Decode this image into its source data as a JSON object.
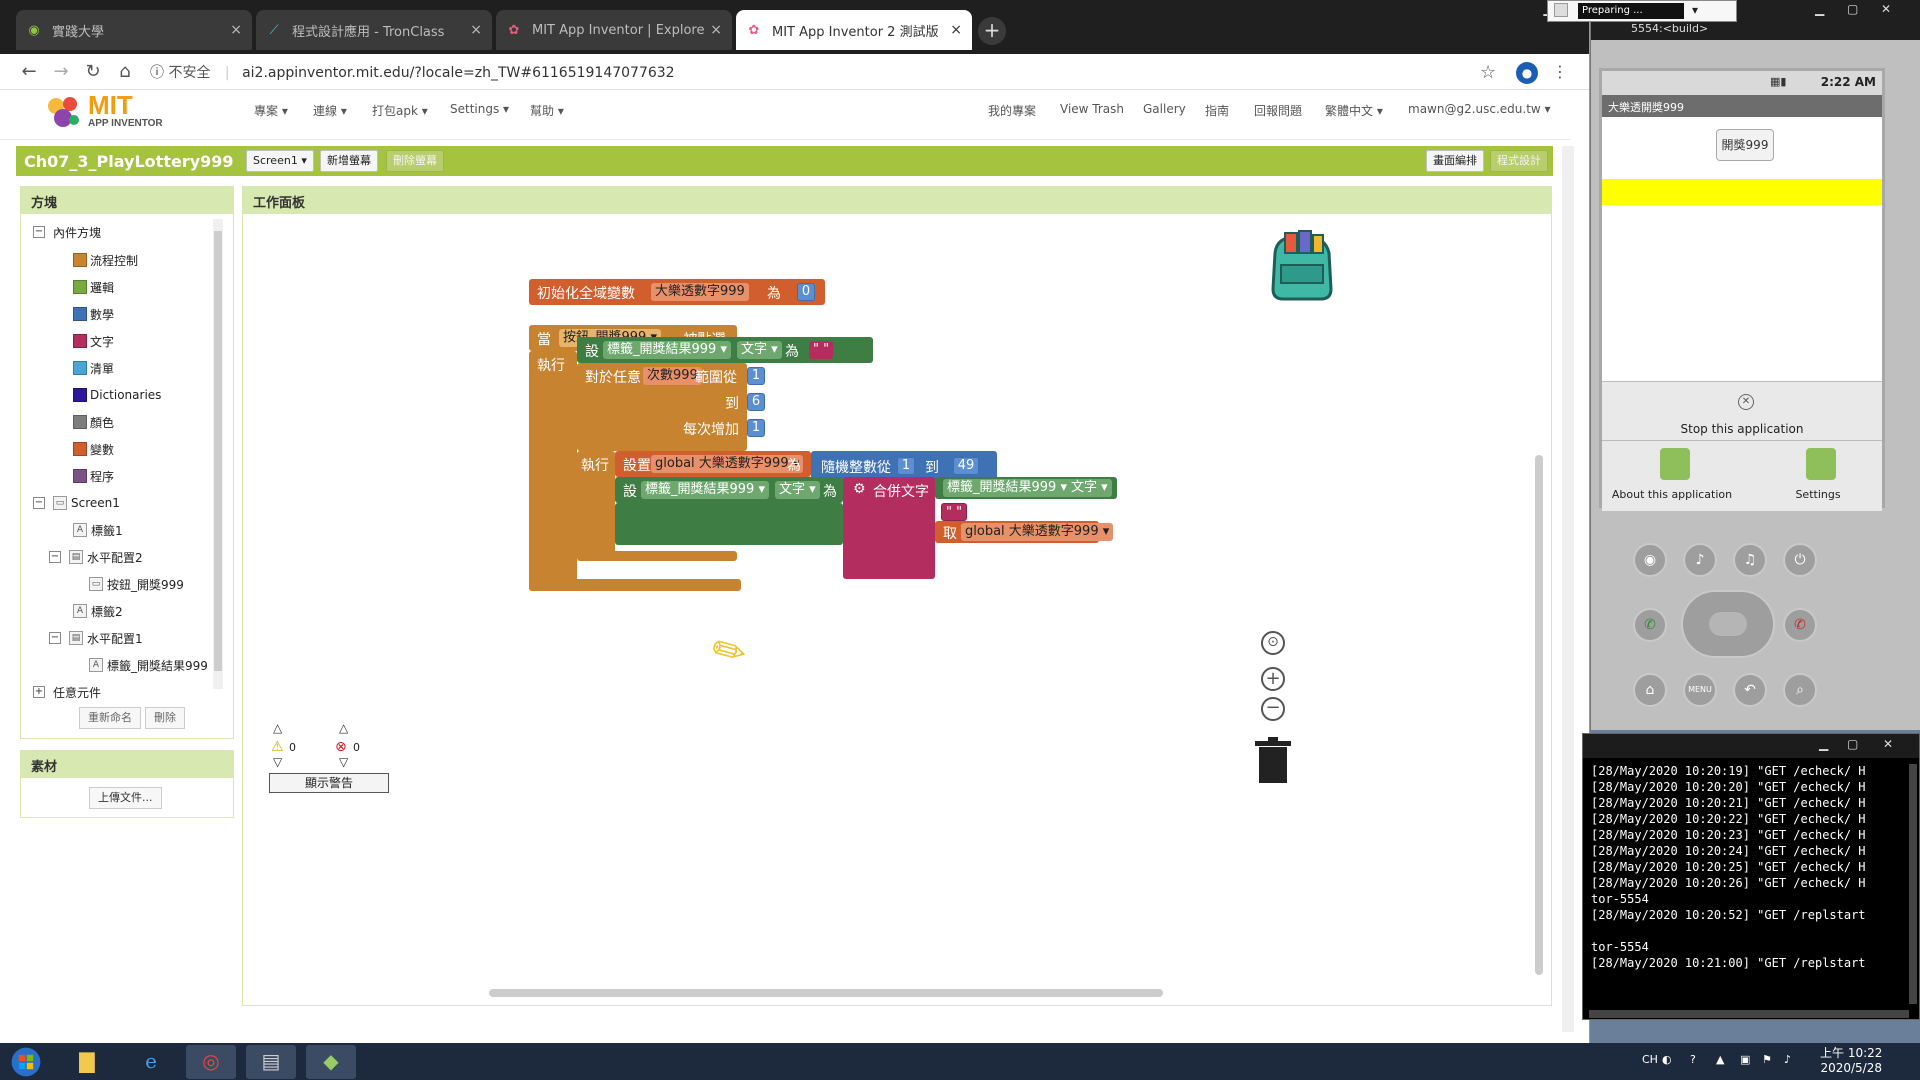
{
  "browser": {
    "tabs": [
      {
        "title": "實踐大學",
        "active": false,
        "favicon": "globe-icon"
      },
      {
        "title": "程式設計應用 - TronClass",
        "active": false,
        "favicon": "tronclass-icon"
      },
      {
        "title": "MIT App Inventor | Explore MIT",
        "active": false,
        "favicon": "app-inventor-icon"
      },
      {
        "title": "MIT App Inventor 2 測試版",
        "active": true,
        "favicon": "app-inventor-icon"
      }
    ],
    "new_tab": "+",
    "insecure_label": "不安全",
    "url": "ai2.appinventor.mit.edu/?locale=zh_TW#6116519147077632"
  },
  "topnav": {
    "logo_title": "MIT",
    "logo_subtitle": "APP INVENTOR",
    "left_menu": [
      "專案 ▾",
      "連線 ▾",
      "打包apk ▾",
      "Settings ▾",
      "幫助 ▾"
    ],
    "right_menu": [
      "我的專案",
      "View Trash",
      "Gallery",
      "指南",
      "回報問題",
      "繁體中文 ▾",
      "mawn@g2.usc.edu.tw ▾"
    ]
  },
  "projectbar": {
    "project_name": "Ch07_3_PlayLottery999",
    "screen_select": "Screen1 ▾",
    "add_screen": "新增螢幕",
    "remove_screen": "刪除螢幕",
    "designer": "畫面編排",
    "blocks": "程式設計"
  },
  "blocks_panel": {
    "header": "方塊",
    "builtin_label": "內件方塊",
    "builtin": [
      {
        "label": "流程控制",
        "color": "#c88330"
      },
      {
        "label": "邏輯",
        "color": "#77ab41"
      },
      {
        "label": "數學",
        "color": "#3f71b5"
      },
      {
        "label": "文字",
        "color": "#b32d5e"
      },
      {
        "label": "清單",
        "color": "#49a6d4"
      },
      {
        "label": "Dictionaries",
        "color": "#2d1799"
      },
      {
        "label": "顏色",
        "color": "#7d7d7d"
      },
      {
        "label": "變數",
        "color": "#d05f2d"
      },
      {
        "label": "程序",
        "color": "#7c5385"
      }
    ],
    "components": [
      {
        "label": "Screen1",
        "level": 0,
        "toggle": "⊟",
        "icon": "screen-icon"
      },
      {
        "label": "標籤1",
        "level": 1,
        "toggle": "",
        "icon": "label-icon"
      },
      {
        "label": "水平配置2",
        "level": 1,
        "toggle": "⊟",
        "icon": "arrangement-icon"
      },
      {
        "label": "按鈕_開獎999",
        "level": 2,
        "toggle": "",
        "icon": "button-icon"
      },
      {
        "label": "標籤2",
        "level": 1,
        "toggle": "",
        "icon": "label-icon"
      },
      {
        "label": "水平配置1",
        "level": 1,
        "toggle": "⊟",
        "icon": "arrangement-icon"
      },
      {
        "label": "標籤_開獎結果999",
        "level": 2,
        "toggle": "",
        "icon": "label-icon"
      }
    ],
    "any_component": "任意元件",
    "rename": "重新命名",
    "delete": "刪除"
  },
  "media_panel": {
    "header": "素材",
    "upload": "上傳文件..."
  },
  "workspace": {
    "header": "工作面板",
    "warnings_count": "0",
    "errors_count": "0",
    "show_warnings": "顯示警告",
    "blocks": {
      "global_init": {
        "prefix": "初始化全域變數",
        "name": "大樂透數字999",
        "as": "為",
        "value": "0"
      },
      "event": {
        "when": "當",
        "component": "按鈕_開獎999 ▾",
        "clicked": ".被點選",
        "do": "執行"
      },
      "set_result_text": {
        "set": "設",
        "component": "標籤_開獎結果999 ▾",
        "prop": "文字 ▾",
        "as": "為",
        "value": "\" \""
      },
      "for_range": {
        "label": "對於任意",
        "var": "次數999",
        "from_label": "範圍從",
        "from": "1",
        "to_label": "到",
        "to": "6",
        "step_label": "每次增加",
        "step": "1",
        "do": "執行"
      },
      "set_global": {
        "set": "設置",
        "var": "global 大樂透數字999 ▾",
        "as": "為",
        "random_label": "隨機整數從",
        "random_from": "1",
        "random_to_label": "到",
        "random_to": "49"
      },
      "set_join": {
        "set": "設",
        "component": "標籤_開獎結果999 ▾",
        "prop": "文字 ▾",
        "as": "為",
        "join_label": "合併文字",
        "arg1_component": "標籤_開獎結果999 ▾",
        "arg1_prop": "文字 ▾",
        "arg2": "\" \"",
        "get_label": "取",
        "get_var": "global 大樂透數字999 ▾"
      }
    }
  },
  "emulator": {
    "window_title": "5554:<build>",
    "preparing": "Preparing ...",
    "status_time": "2:22 AM",
    "app_title": "大樂透開獎999",
    "button_label": "開獎999",
    "stop_app": "Stop this application",
    "about_app": "About this application",
    "settings": "Settings",
    "controls_row1": [
      "camera-icon",
      "volume-down-icon",
      "volume-up-icon",
      "power-icon"
    ],
    "controls_row3": [
      "home-icon",
      "menu-icon",
      "back-icon",
      "search-icon"
    ],
    "menu_btn_label": "MENU"
  },
  "console": {
    "lines": [
      "[28/May/2020 10:20:19] \"GET /echeck/ H",
      "[28/May/2020 10:20:20] \"GET /echeck/ H",
      "[28/May/2020 10:20:21] \"GET /echeck/ H",
      "[28/May/2020 10:20:22] \"GET /echeck/ H",
      "[28/May/2020 10:20:23] \"GET /echeck/ H",
      "[28/May/2020 10:20:24] \"GET /echeck/ H",
      "[28/May/2020 10:20:25] \"GET /echeck/ H",
      "[28/May/2020 10:20:26] \"GET /echeck/ H",
      "tor-5554",
      "[28/May/2020 10:20:52] \"GET /replstart",
      "",
      "tor-5554",
      "[28/May/2020 10:21:00] \"GET /replstart"
    ]
  },
  "taskbar": {
    "lang": "CH",
    "time": "上午 10:22",
    "date": "2020/5/28"
  }
}
